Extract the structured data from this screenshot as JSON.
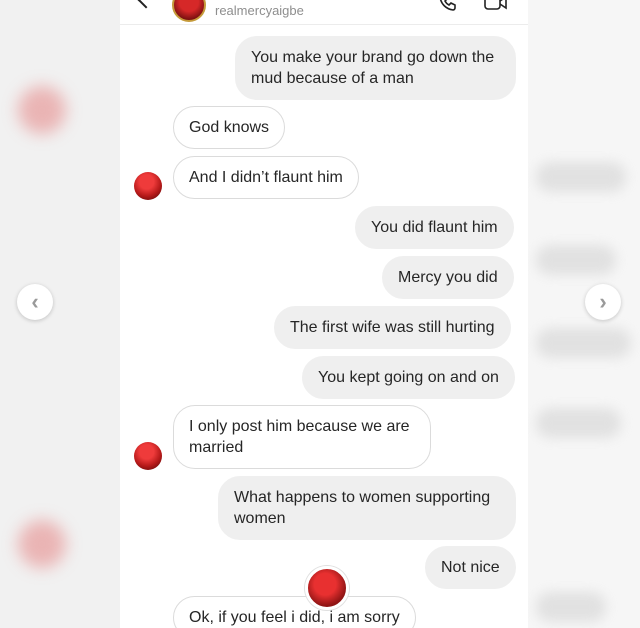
{
  "header": {
    "username": "realmercyaigbe"
  },
  "messages": [
    {
      "side": "out",
      "text": "You make your brand go down the mud because of a man"
    },
    {
      "side": "in",
      "text": "God knows"
    },
    {
      "side": "in",
      "text": "And I didn’t flaunt him"
    },
    {
      "side": "out",
      "text": "You did flaunt him"
    },
    {
      "side": "out",
      "text": "Mercy you did"
    },
    {
      "side": "out",
      "text": "The first wife was still hurting"
    },
    {
      "side": "out",
      "text": "You kept going on and on"
    },
    {
      "side": "in",
      "text": "I only post him because we are married"
    },
    {
      "side": "out",
      "text": "What happens to women supporting women"
    },
    {
      "side": "out",
      "text": "Not nice"
    },
    {
      "side": "in",
      "text": "Ok, if you feel i did, i am sorry"
    }
  ],
  "carousel": {
    "prev_symbol": "‹",
    "next_symbol": "›"
  },
  "colors": {
    "incoming_bg": "#ffffff",
    "outgoing_bg": "#efefef",
    "avatar_red": "#d62828"
  }
}
